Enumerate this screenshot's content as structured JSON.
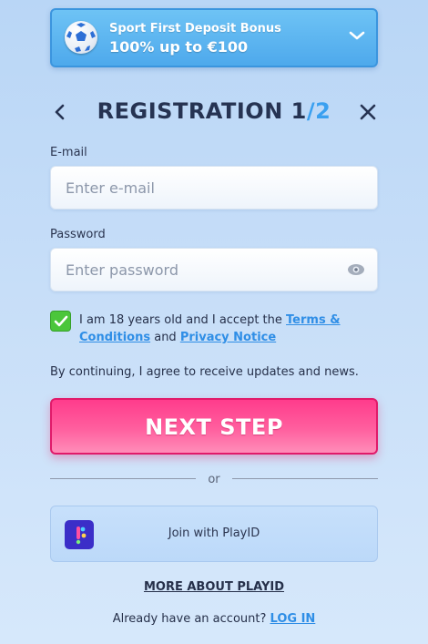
{
  "bonus": {
    "title": "Sport First Deposit Bonus",
    "offer": "100% up to €100",
    "icon": "soccer-ball-icon"
  },
  "header": {
    "title": "REGISTRATION 1",
    "step": "/2"
  },
  "email": {
    "label": "E-mail",
    "placeholder": "Enter e-mail",
    "value": ""
  },
  "password": {
    "label": "Password",
    "placeholder": "Enter password",
    "value": ""
  },
  "terms": {
    "checked": true,
    "prefix": "I am 18 years old and I accept the ",
    "terms_link": "Terms & Conditions",
    "middle": " and ",
    "privacy_link": "Privacy Notice"
  },
  "updates_text": "By continuing, I agree to receive updates and news.",
  "next_button": "NEXT STEP",
  "divider_text": "or",
  "playid": {
    "label": "Join with PlayID"
  },
  "more_link": "MORE ABOUT PLAYID",
  "login": {
    "prompt": "Already have an account? ",
    "link": "LOG IN"
  },
  "colors": {
    "accent": "#3aa0f0",
    "primary_button": "#ff4f95",
    "check_green": "#4bc63b",
    "link": "#2f8ee6"
  }
}
